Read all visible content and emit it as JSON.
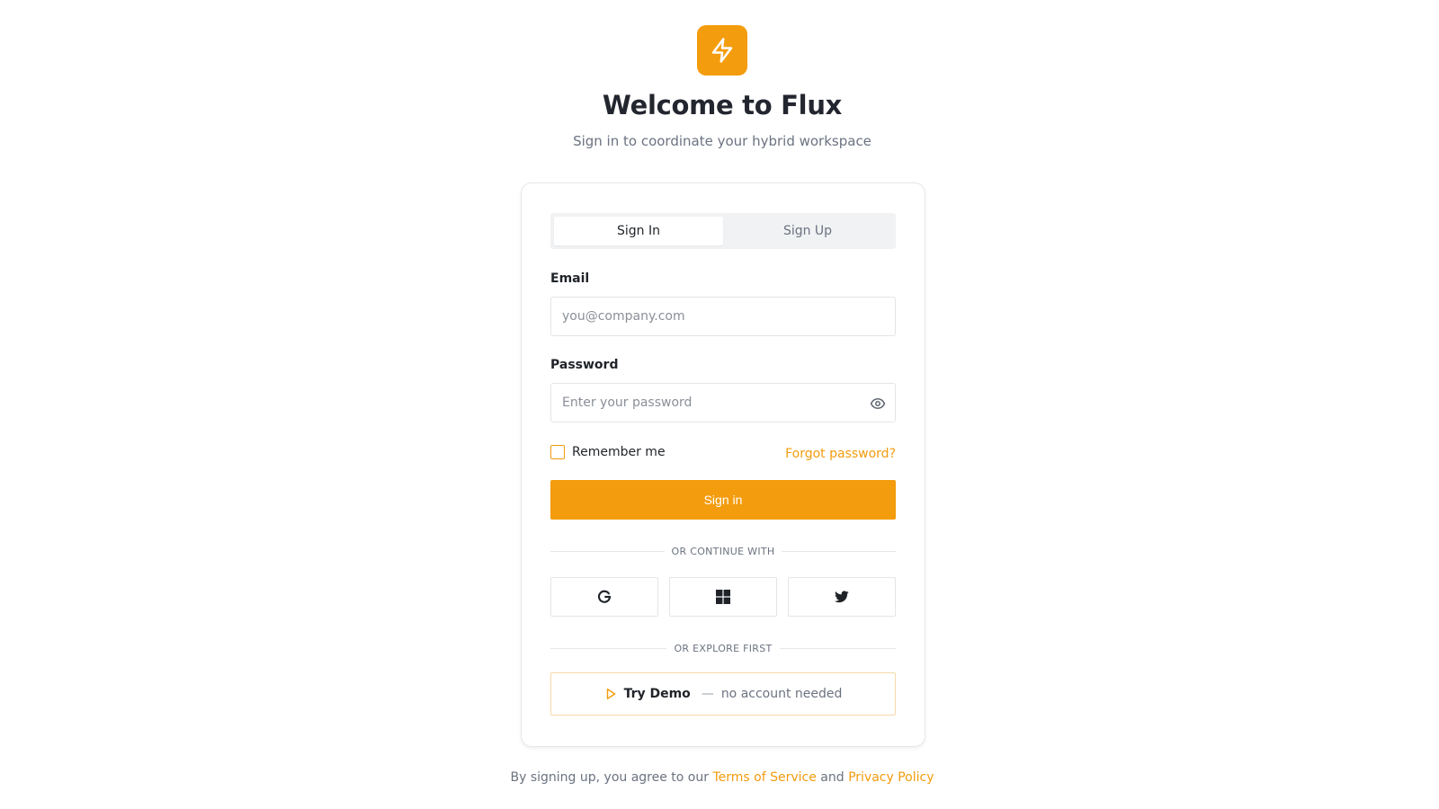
{
  "brand": {
    "logo_icon": "lightning-bolt-icon",
    "title": "Welcome to Flux",
    "subtitle": "Sign in to coordinate your hybrid workspace",
    "accent_color": "#f39c0d"
  },
  "tabs": [
    {
      "label": "Sign In",
      "active": true
    },
    {
      "label": "Sign Up",
      "active": false
    }
  ],
  "form": {
    "email_label": "Email",
    "email_placeholder": "you@company.com",
    "email_value": "",
    "password_label": "Password",
    "password_placeholder": "Enter your password",
    "password_value": "",
    "password_toggle_icon": "eye-icon",
    "remember_label": "Remember me",
    "remember_checked": false,
    "forgot_label": "Forgot password?",
    "submit_label": "Sign in"
  },
  "social": {
    "divider_label": "OR CONTINUE WITH",
    "providers": [
      {
        "name": "google",
        "icon": "google-icon"
      },
      {
        "name": "microsoft",
        "icon": "windows-icon"
      },
      {
        "name": "twitter",
        "icon": "twitter-icon"
      }
    ]
  },
  "demo": {
    "divider_label": "OR EXPLORE FIRST",
    "icon": "play-icon",
    "label": "Try Demo",
    "dash": "—",
    "sublabel": "no account needed"
  },
  "footer": {
    "prefix": "By signing up, you agree to our ",
    "terms_label": "Terms of Service",
    "and_text": " and ",
    "privacy_label": "Privacy Policy"
  }
}
